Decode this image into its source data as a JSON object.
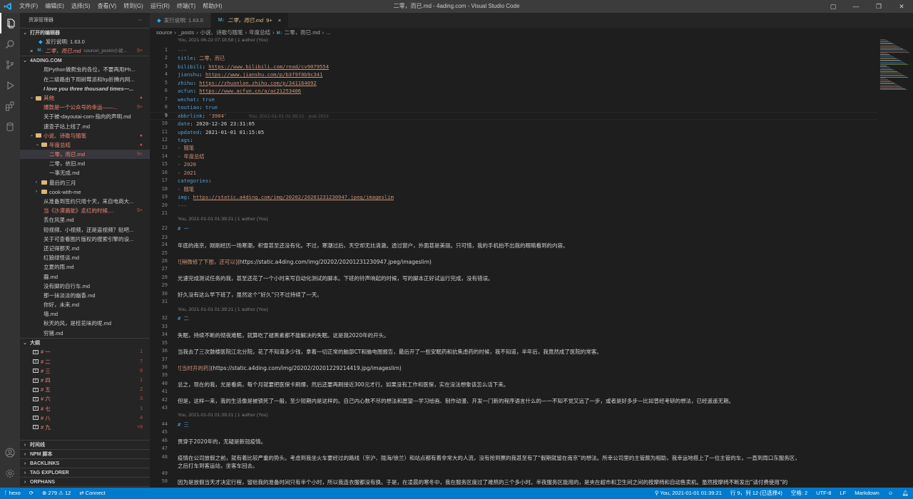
{
  "titlebar": {
    "menu": [
      "文件(F)",
      "编辑(E)",
      "选择(S)",
      "查看(V)",
      "转到(G)",
      "运行(R)",
      "终端(T)",
      "帮助(H)"
    ],
    "window_title": "二零，而已.md - 4ading.com - Visual Studio Code"
  },
  "sidebar": {
    "title": "资源管理器",
    "more": "···",
    "open_editors_header": "打开的编辑器",
    "open_editors": [
      {
        "name": "发行说明: 1.63.0",
        "path": ""
      },
      {
        "name": "二零，而已.md",
        "path": "source\\_posts\\小说...",
        "badge": "9+"
      }
    ],
    "workspace_header": "4ADING.COM",
    "tree": [
      {
        "label": "用Python做爬虫的各位，不要再用Ph...",
        "indent": 2,
        "type": "file"
      },
      {
        "label": "在二级路由下用树莓派和frp折腾内网...",
        "indent": 2,
        "type": "file"
      },
      {
        "label": "I love you three thousand times—...",
        "indent": 2,
        "type": "file-italic"
      },
      {
        "label": "其他",
        "indent": 1,
        "type": "folder-open",
        "badge": "●",
        "color": "mod"
      },
      {
        "label": "爆款是一个公众号的幸运——...",
        "indent": 2,
        "type": "file",
        "badge": "9+",
        "color": "err"
      },
      {
        "label": "关于被-dayoutai-com-指向的声明.md",
        "indent": 2,
        "type": "file"
      },
      {
        "label": "速查子站上线了.md",
        "indent": 2,
        "type": "file"
      },
      {
        "label": "小说、诗歌与随笔",
        "indent": 1,
        "type": "folder-open",
        "badge": "●",
        "color": "mod"
      },
      {
        "label": "年度总结",
        "indent": 2,
        "type": "folder-open",
        "badge": "●",
        "color": "mod"
      },
      {
        "label": "二零，而已.md",
        "indent": 3,
        "type": "file",
        "badge": "9+",
        "color": "err",
        "selected": true
      },
      {
        "label": "二零，依旧.md",
        "indent": 3,
        "type": "file"
      },
      {
        "label": "一事无成.md",
        "indent": 3,
        "type": "file"
      },
      {
        "label": "最后的三月",
        "indent": 2,
        "type": "folder-closed"
      },
      {
        "label": "cook-with-me",
        "indent": 2,
        "type": "folder-closed"
      },
      {
        "label": "从准备到签约只用十天，来自电商大...",
        "indent": 2,
        "type": "file"
      },
      {
        "label": "当《沙漠骆驼》走红的时候,...",
        "indent": 2,
        "type": "file",
        "badge": "9+",
        "color": "err"
      },
      {
        "label": "丢在风里.md",
        "indent": 2,
        "type": "file"
      },
      {
        "label": "短视频、小视频，还是盗视频？贴吧...",
        "indent": 2,
        "type": "file"
      },
      {
        "label": "关于可查看图片版权的搜索引擎的设...",
        "indent": 2,
        "type": "file"
      },
      {
        "label": "还记得那天.md",
        "indent": 2,
        "type": "file"
      },
      {
        "label": "红狼绿怪谈.md",
        "indent": 2,
        "type": "file"
      },
      {
        "label": "立夏的雨.md",
        "indent": 2,
        "type": "file"
      },
      {
        "label": "霾.md",
        "indent": 2,
        "type": "file"
      },
      {
        "label": "没有脚的自行车.md",
        "indent": 2,
        "type": "file"
      },
      {
        "label": "那一抹淡淡的幽香.md",
        "indent": 2,
        "type": "file"
      },
      {
        "label": "你好，未来.md",
        "indent": 2,
        "type": "file"
      },
      {
        "label": "墙.md",
        "indent": 2,
        "type": "file"
      },
      {
        "label": "秋天的风，是桂花味的呢.md",
        "indent": 2,
        "type": "file"
      },
      {
        "label": "穷猪.md",
        "indent": 2,
        "type": "file"
      }
    ],
    "outline_header": "大纲",
    "outline": [
      {
        "label": "# 一",
        "badge": "1"
      },
      {
        "label": "# 二",
        "badge": "7"
      },
      {
        "label": "# 三",
        "badge": "6"
      },
      {
        "label": "# 四",
        "badge": "1"
      },
      {
        "label": "# 五",
        "badge": "2"
      },
      {
        "label": "# 六",
        "badge": "3"
      },
      {
        "label": "# 七",
        "badge": "1"
      },
      {
        "label": "# 八",
        "badge": "4"
      },
      {
        "label": "# 九",
        "badge": "+9"
      }
    ],
    "bottom_sections": [
      "时间线",
      "NPM 脚本",
      "BACKLINKS",
      "TAG EXPLORER",
      "ORPHANS",
      "PLACEHOLDERS"
    ]
  },
  "tabs": [
    {
      "label": "发行说明: 1.63.0",
      "active": false
    },
    {
      "label": "二零，而已.md",
      "badge": "9+",
      "active": true,
      "close": "×"
    }
  ],
  "breadcrumb": [
    "source",
    "_posts",
    "小说、诗歌与随笔",
    "年度总结",
    "M↓",
    "二零，而已.md",
    "..."
  ],
  "editor": {
    "blame_top": "You, 2021-06-22 07:18:58 | 1 author (You)",
    "inline_blame": "You, 2021-01-01 01:39:21 · pub 2021",
    "blame_1": "You, 2021-01-01 01:39:21 | 1 author (You)",
    "blame_2": "You, 2021-01-01 01:39:21 | 1 author (You)",
    "blame_3": "You, 2021-01-01 01:39:21 | 1 author (You)",
    "lines": {
      "l1": "---",
      "l2k": "title",
      "l2v": "二零，而已",
      "l3k": "bilibili",
      "l3v": "https://www.bilibili.com/read/cv9079554",
      "l4k": "jianshu",
      "l4v": "https://www.jianshu.com/p/b3f9f0b9c341",
      "l5k": "zhihu",
      "l5v": "https://zhuanlan.zhihu.com/p/341164092",
      "l6k": "acfun",
      "l6v": "https://www.acfun.cn/a/ac21253406",
      "l7k": "wechat",
      "l7v": "true",
      "l8k": "toutiao",
      "l8v": "true",
      "l9k": "abbrlink",
      "l9v": "'3904'",
      "l10k": "date",
      "l10v": "2020-12-26 23:31:05",
      "l11k": "updated",
      "l11v": "2021-01-01 01:15:05",
      "l12k": "tags",
      "l13": "- 随笔",
      "l14": "- 年度总结",
      "l15": "- 2020",
      "l16": "- 2021",
      "l17k": "categories",
      "l18": "- 随笔",
      "l19k": "img",
      "l19v": "https://static.a4ding.com/img/20202/20201231230947.jpeg/imageslim",
      "l20": "---",
      "l22": "# 一",
      "l24": "年底的南京，刚刚经历一场寒潮，积雪甚至还没有化。不过，寒潮过后，天空却无比清澈。透过窗户，外面甚是美丽。只可惜，我的手机拍不出我的眼睛看到的内容。",
      "l26a": "![稍微修了下图，还可以]",
      "l26b": "(https://static.a4ding.com/img/20202/20201231230947.jpeg/imageslim)",
      "l28": "光速完成测试任务的我，甚至还花了一个小时来写自动化测试的脚本。下班的铃声响起的时候，写的脚本正好试运行完成，没有错误。",
      "l30": "好久没有这么早下班了，虽然这个“好久”只不过持续了一天。",
      "l32": "# 二",
      "l34": "失眠，持续不断的彻夜难眠，就算吃了褪黑素都不能解决的失眠。这是我2020年的开头。",
      "l36": "当我去了三次鼓楼医院江北分院，花了不知道多少钱，拿着一切正常的脑部CT和脑电图报告，最后开了一些安眠药和抗焦虑药的时候，我不知道，半年后，我竟然成了医院的常客。",
      "l38a": "![当时开的药]",
      "l38b": "(https://static.a4ding.com/img/20202/20201229214419.jpg/imageslim)",
      "l40": "总之，现在的我，光是看病，每个月就要把医保卡刷爆，然后还要再刷接近300元才行。如果没有工作和医保，实在没法想象该怎么活下来。",
      "l42": "但是，这样一来，我的生活像是被锁死了一般，至少短期内是这样的。自己内心数不尽的想法和愿望—学习绘画、制作动漫、开发一门新的程序语言什么的—一不知不觉又远了一步，或者是好多步—比如曾经考研的想法，已经遥遥无期。",
      "l44": "# 三",
      "l46": "贯穿于2020年的，无疑是新冠疫情。",
      "l48": "疫情在公司放假之前，就有着比较严重的势头。考虑到我坐火车要经过的路线（京沪、陇海/徐兰）和站点都有着非常大的人流，没有抢到票的我甚至有了“假期就留在南京”的想法。所幸公司里的主管颇为相助，我幸运地搭上了一位主管的车，一直到周口东服务区，",
      "l48b": "之后打车到客运站，坐客车回去。",
      "l50": "因为是放假当天才决定行程，留给我的准备时间只有半个小时，所以我连衣服都没有换。于是，在凌晨的寒冬中，我在服务区度过了难熬的三个多小时。半夜服务区能用的，是夹在超市和卫生间之间的按摩椅和自动售卖机。虽然按摩椅不断发出“请付费使用”的"
    }
  },
  "statusbar": {
    "branch": "hexo",
    "sync": "⟳",
    "warnings": "⊗ 279",
    "warn2": "⚠ 12",
    "connect": "Connect",
    "blame": "You, 2021-01-01 01:39:21",
    "position": "行 9，列 12 (已选择4)",
    "spaces": "空格: 2",
    "encoding": "UTF-8",
    "eol": "LF",
    "language": "Markdown"
  }
}
